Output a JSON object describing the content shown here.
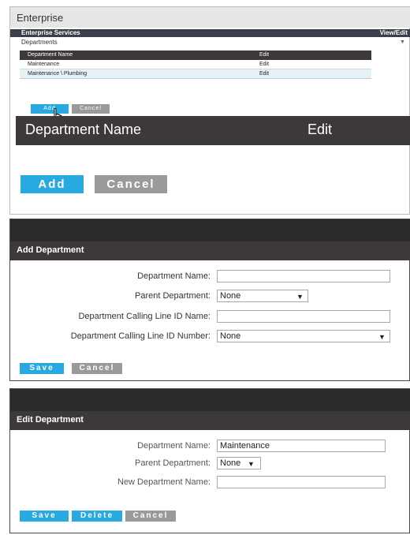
{
  "enterprise_panel": {
    "title": "Enterprise",
    "subbar_left": "Enterprise Services",
    "subbar_right": "View/Edit",
    "section_label": "Departments",
    "section_arrow": "▼",
    "table": {
      "headers": [
        "Department Name",
        "Edit"
      ],
      "rows": [
        {
          "name": "Maintenance",
          "edit": "Edit"
        },
        {
          "name": "Maintenance \\ Plumbing",
          "edit": "Edit"
        }
      ]
    },
    "add_label": "Add",
    "cancel_label": "Cancel",
    "cursor_icon": "hand-pointer-icon",
    "zoom": {
      "col1": "Department Name",
      "col2": "Edit",
      "add_label": "Add",
      "cancel_label": "Cancel"
    }
  },
  "add_department": {
    "title": "Add Department",
    "fields": {
      "dept_name_label": "Department Name:",
      "dept_name_value": "",
      "parent_label": "Parent Department:",
      "parent_value": "None",
      "clid_name_label": "Department Calling Line ID Name:",
      "clid_name_value": "",
      "clid_number_label": "Department Calling Line ID Number:",
      "clid_number_value": "None"
    },
    "save_label": "Save",
    "cancel_label": "Cancel"
  },
  "edit_department": {
    "title": "Edit Department",
    "fields": {
      "dept_name_label": "Department Name:",
      "dept_name_value": "Maintenance",
      "parent_label": "Parent Department:",
      "parent_value": "None",
      "new_name_label": "New Department Name:",
      "new_name_value": ""
    },
    "save_label": "Save",
    "delete_label": "Delete",
    "cancel_label": "Cancel"
  },
  "colors": {
    "accent_blue": "#28a9e0",
    "header_dark": "#3d3939",
    "button_gray": "#9a9a9a"
  }
}
